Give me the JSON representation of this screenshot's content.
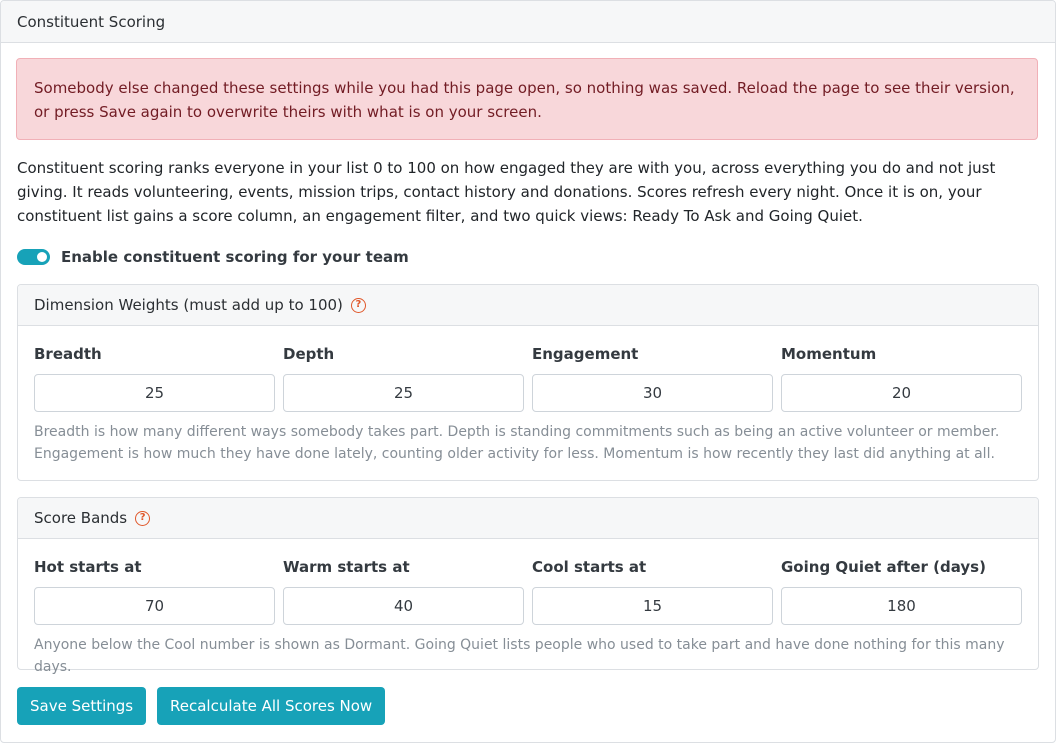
{
  "header": {
    "title": "Constituent Scoring"
  },
  "alert": {
    "text": "Somebody else changed these settings while you had this page open, so nothing was saved. Reload the page to see their version, or press Save again to overwrite theirs with what is on your screen."
  },
  "intro": {
    "text": "Constituent scoring ranks everyone in your list 0 to 100 on how engaged they are with you, across everything you do and not just giving. It reads volunteering, events, mission trips, contact history and donations. Scores refresh every night. Once it is on, your constituent list gains a score column, an engagement filter, and two quick views: Ready To Ask and Going Quiet."
  },
  "toggle": {
    "label": "Enable constituent scoring for your team",
    "enabled": true,
    "color": "#17a2b8"
  },
  "weights": {
    "title": "Dimension Weights (must add up to 100)",
    "help_icon": "question-circle-icon",
    "fields": [
      {
        "label": "Breadth",
        "value": "25"
      },
      {
        "label": "Depth",
        "value": "25"
      },
      {
        "label": "Engagement",
        "value": "30"
      },
      {
        "label": "Momentum",
        "value": "20"
      }
    ],
    "help": "Breadth is how many different ways somebody takes part. Depth is standing commitments such as being an active volunteer or member. Engagement is how much they have done lately, counting older activity for less. Momentum is how recently they last did anything at all."
  },
  "bands": {
    "title": "Score Bands",
    "help_icon": "question-circle-icon",
    "fields": [
      {
        "label": "Hot starts at",
        "value": "70"
      },
      {
        "label": "Warm starts at",
        "value": "40"
      },
      {
        "label": "Cool starts at",
        "value": "15"
      },
      {
        "label": "Going Quiet after (days)",
        "value": "180"
      }
    ],
    "help": "Anyone below the Cool number is shown as Dormant. Going Quiet lists people who used to take part and have done nothing for this many days."
  },
  "actions": {
    "save_label": "Save Settings",
    "recalculate_label": "Recalculate All Scores Now"
  },
  "colors": {
    "accent": "#17a2b8",
    "alert_bg": "#f8d7da",
    "alert_text": "#721c24",
    "help_icon": "#e0582b"
  }
}
